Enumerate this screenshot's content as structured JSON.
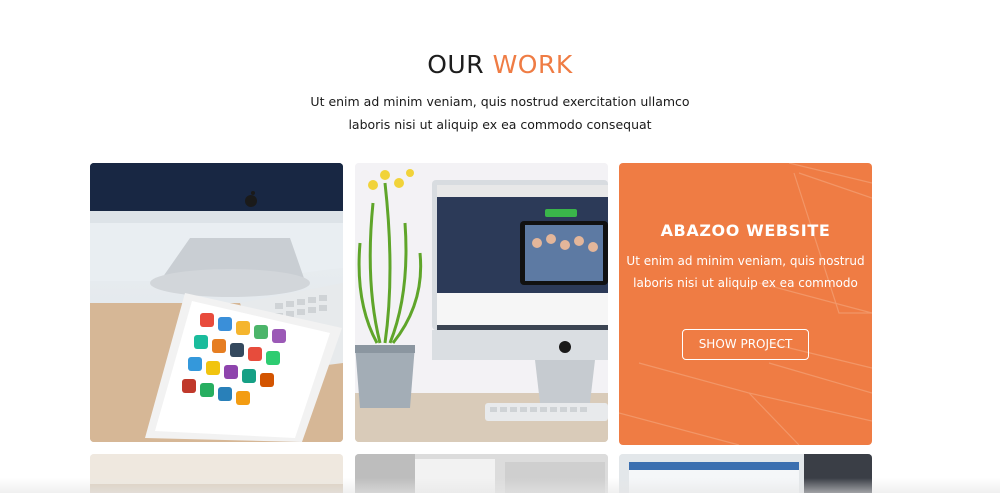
{
  "section": {
    "title_main": "OUR",
    "title_accent": "WORK",
    "subtitle_line1": "Ut enim ad minim veniam, quis nostrud exercitation ullamco",
    "subtitle_line2": "laboris nisi ut aliquip ex ea commodo consequat"
  },
  "colors": {
    "accent": "#ef7c44",
    "text": "#1d1d1d",
    "overlay_text": "#ffffff"
  },
  "projects": [
    {
      "image": "imac-ipad-desk-photo"
    },
    {
      "image": "imac-plant-desk-photo"
    },
    {
      "image": "laptop-photo-orange-overlay",
      "title": "ABAZOO WEBSITE",
      "text_line1": "Ut enim ad minim veniam, quis nostrud",
      "text_line2": "laboris nisi ut aliquip ex ea commodo",
      "button_label": "SHOW PROJECT"
    },
    {
      "image": "desk-photo"
    },
    {
      "image": "magazine-photo"
    },
    {
      "image": "laptop-screen-photo"
    }
  ]
}
